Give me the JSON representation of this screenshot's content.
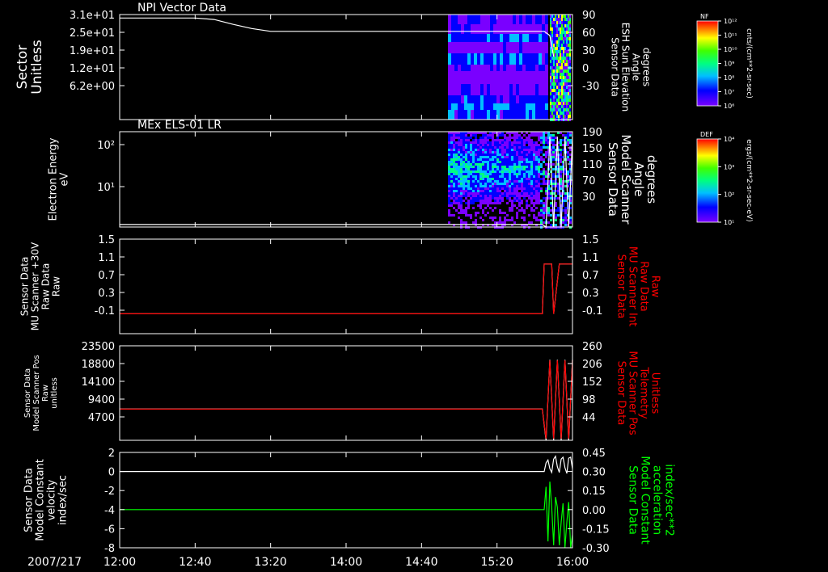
{
  "colors": {
    "background": "#000000",
    "axis": "#ffffff",
    "trace_white": "#ffffff",
    "trace_red": "#ff0000",
    "trace_green": "#00ff00"
  },
  "chart_data": [
    {
      "type": "heatmap",
      "title": "NPI Vector Data",
      "ylabel": [
        "Sector",
        "Unitless"
      ],
      "yticks": [
        "3.1e+01",
        "2.5e+01",
        "1.9e+01",
        "1.2e+01",
        "6.2e+00"
      ],
      "y2label": [
        "Sensor Data",
        "ESH Sun Elevation",
        "Angle",
        "degrees"
      ],
      "y2ticks": [
        "90",
        "60",
        "30",
        "0",
        "-30"
      ],
      "y2lim": [
        -60,
        90
      ],
      "colorbar": {
        "label": "NF",
        "units": "cnts/(cm**2-sr-sec)",
        "ticks": [
          "10¹²",
          "10¹¹",
          "10¹⁰",
          "10⁹",
          "10⁸",
          "10⁷",
          "10⁶"
        ]
      },
      "series": [
        {
          "color": "white",
          "axis": "right",
          "x": [
            "12:00",
            "12:40",
            "12:50",
            "13:00",
            "13:10",
            "13:20",
            "14:00",
            "15:00",
            "15:45",
            "15:48",
            "15:50"
          ],
          "values": [
            85,
            85,
            83,
            76,
            70,
            66,
            66,
            66,
            66,
            60,
            30
          ]
        }
      ]
    },
    {
      "type": "heatmap",
      "title": "MEx ELS-01 LR",
      "ylabel": [
        "Electron Energy",
        "eV"
      ],
      "yticks": [
        "10²",
        "10¹"
      ],
      "ylim": [
        1,
        200
      ],
      "y2label": [
        "Sensor Data",
        "Model Scanner",
        "Angle",
        "degrees"
      ],
      "y2ticks": [
        "190",
        "150",
        "110",
        "70",
        "30"
      ],
      "y2lim": [
        0,
        190
      ],
      "colorbar": {
        "label": "DEF",
        "units": "ergs/(cm**2-sr-sec-eV)",
        "ticks": [
          "10⁴",
          "10³",
          "10²",
          "10¹"
        ]
      },
      "series": [
        {
          "color": "white",
          "axis": "right",
          "x": [
            "12:00",
            "15:30",
            "15:44",
            "15:46",
            "15:48",
            "15:50",
            "15:52",
            "15:54",
            "15:56",
            "15:58",
            "16:00"
          ],
          "values": [
            5,
            5,
            5,
            0,
            180,
            0,
            180,
            0,
            180,
            0,
            180
          ]
        }
      ]
    },
    {
      "type": "line",
      "ylabel": [
        "Sensor Data",
        "MU Scanner +30V",
        "Raw Data",
        "Raw"
      ],
      "yticks": [
        "1.5",
        "1.1",
        "0.7",
        "0.3",
        "-0.1"
      ],
      "ylim": [
        -0.4,
        1.5
      ],
      "y2label": [
        "Sensor Data",
        "MU Scanner Int",
        "Raw Data",
        "Raw"
      ],
      "y2ticks": [
        "1.5",
        "1.1",
        "0.7",
        "0.3",
        "-0.1"
      ],
      "y2lim": [
        -0.4,
        1.5
      ],
      "series": [
        {
          "color": "white",
          "axis": "left",
          "x": [
            "12:00",
            "15:44",
            "15:45",
            "15:49",
            "15:50",
            "15:53",
            "15:54",
            "16:00"
          ],
          "values": [
            0,
            0,
            1,
            1,
            0,
            1,
            1,
            1
          ]
        },
        {
          "color": "red",
          "axis": "right",
          "x": [
            "12:00",
            "15:44",
            "15:45",
            "15:49",
            "15:50",
            "15:53",
            "15:54",
            "16:00"
          ],
          "values": [
            0,
            0,
            1,
            1,
            0,
            1,
            1,
            1
          ]
        }
      ]
    },
    {
      "type": "line",
      "ylabel": [
        "Sensor Data",
        "Model Scanner Pos",
        "Raw",
        "unitless"
      ],
      "yticks": [
        "23500",
        "18800",
        "14100",
        "9400",
        "4700"
      ],
      "ylim": [
        0,
        23500
      ],
      "y2label": [
        "Sensor Data",
        "MU Scanner Pos",
        "Telemetry",
        "Unitless"
      ],
      "y2ticks": [
        "260",
        "206",
        "152",
        "98",
        "44"
      ],
      "y2lim": [
        0,
        260
      ],
      "series": [
        {
          "color": "white",
          "axis": "left",
          "x": [
            "12:00",
            "15:43",
            "15:44",
            "15:46",
            "15:48",
            "15:50",
            "15:52",
            "15:54",
            "15:56",
            "15:58",
            "16:00"
          ],
          "values": [
            7800,
            7800,
            7800,
            0,
            20000,
            0,
            20000,
            0,
            20000,
            0,
            20000
          ]
        },
        {
          "color": "red",
          "axis": "right",
          "x": [
            "12:00",
            "15:43",
            "15:44",
            "15:46",
            "15:48",
            "15:50",
            "15:52",
            "15:54",
            "15:56",
            "15:58",
            "16:00"
          ],
          "values": [
            86,
            86,
            86,
            5,
            220,
            5,
            220,
            5,
            220,
            5,
            220
          ]
        }
      ]
    },
    {
      "type": "line",
      "ylabel": [
        "Sensor Data",
        "Model Constant",
        "velocity",
        "index/sec"
      ],
      "yticks": [
        "2",
        "0",
        "-2",
        "-4",
        "-6",
        "-8"
      ],
      "ylim": [
        -8,
        2
      ],
      "y2label": [
        "Sensor Data",
        "Model Constant",
        "acceleration",
        "index/sec**2"
      ],
      "y2ticks": [
        "0.45",
        "0.30",
        "0.15",
        "0.00",
        "-0.15",
        "-0.30"
      ],
      "y2lim": [
        -0.3,
        0.45
      ],
      "series": [
        {
          "color": "white",
          "axis": "left",
          "x": [
            "12:00",
            "15:44",
            "15:45",
            "15:46",
            "15:47",
            "15:48",
            "15:49",
            "15:50",
            "15:51",
            "15:52",
            "15:53",
            "15:54",
            "15:55",
            "15:56",
            "15:57",
            "15:58",
            "15:59",
            "16:00"
          ],
          "values": [
            0,
            0,
            0,
            0.9,
            1.2,
            0.3,
            -0.1,
            1.3,
            1.6,
            0.5,
            -0.1,
            1.3,
            1.5,
            0.4,
            -0.2,
            1.4,
            1.5,
            0.3
          ]
        },
        {
          "color": "green",
          "axis": "right",
          "x": [
            "12:00",
            "15:44",
            "15:45",
            "15:46",
            "15:47",
            "15:48",
            "15:49",
            "15:50",
            "15:51",
            "15:52",
            "15:53",
            "15:54",
            "15:55",
            "15:56",
            "15:57",
            "15:58",
            "15:59",
            "16:00"
          ],
          "values": [
            0,
            0,
            0,
            0.18,
            -0.25,
            0.22,
            0.02,
            -0.28,
            0.1,
            0.02,
            -0.28,
            -0.1,
            0.05,
            -0.3,
            -0.1,
            0.06,
            -0.3,
            -0.2
          ]
        }
      ]
    }
  ],
  "x_axis": {
    "date": "2007/217",
    "ticks": [
      "12:00",
      "12:40",
      "13:20",
      "14:00",
      "14:40",
      "15:20",
      "16:00"
    ],
    "range": [
      "12:00",
      "16:00"
    ]
  }
}
